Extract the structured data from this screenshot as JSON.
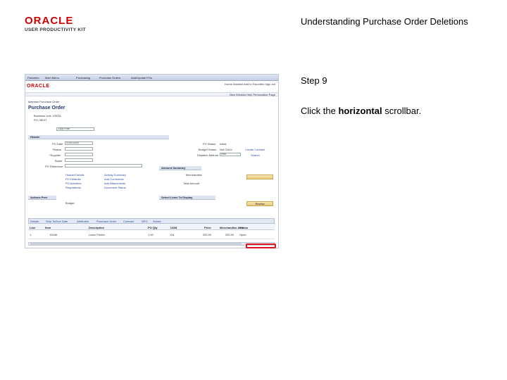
{
  "header": {
    "logo_text": "ORACLE",
    "logo_sub": "USER PRODUCTIVITY KIT",
    "document_title": "Understanding Purchase Order Deletions"
  },
  "step": {
    "label": "Step 9",
    "instruction_prefix": "Click the ",
    "instruction_bold": "horizontal",
    "instruction_suffix": " scrollbar."
  },
  "screenshot": {
    "tabs": [
      "Favorites",
      "Main Menu",
      "Purchasing",
      "Purchase Orders",
      "Add/Update POs"
    ],
    "brand": "ORACLE",
    "nav_links": "Home  Worklist  Add to Favorites  Sign out",
    "bar_links": "New Window  Help  Personalize Page",
    "breadcrumb": "Maintain Purchase Order",
    "page_title": "Purchase Order",
    "fields": {
      "business_unit_label": "Business Unit: US001",
      "po_label": "PO: NEXT",
      "copy_from": "Copy From",
      "header": "Header",
      "po_date_label": "PO Date",
      "po_date": "01/01/2009",
      "status_label": "*Status",
      "supplier_label": "*Supplier",
      "buyer_label": "Buyer",
      "po_ref_label": "PO Reference",
      "po_status_label": "PO Status",
      "po_status": "Initial",
      "budget_status_label": "Budget Status",
      "budget_status": "Not Chk'd",
      "dispatch_label": "Dispatch Method",
      "dispatch": "Print",
      "amount_summary": "Amount Summary",
      "merch_total": "Merchandise",
      "total_amount": "Total Amount",
      "create_contract": "Create Contract",
      "search": "Search"
    },
    "links": [
      "Header Details",
      "PO Defaults",
      "PO Activities",
      "Requisitions",
      "Activity Summary",
      "Add Comments",
      "Add Attachments",
      "Document Status"
    ],
    "actions_label": "Actions Prev",
    "budget_label": "Budget",
    "select_lines": "Select Lines To Display",
    "review_button": "Review",
    "grid_tabs": [
      "Details",
      "Ship To/Due Date",
      "Attributes",
      "Purchase Order",
      "Contract",
      "SPO",
      "Sched"
    ],
    "grid_headers": [
      "Line",
      "Item",
      "Description",
      "PO Qty",
      "UOM",
      "Price",
      "Merchandise Amt",
      "Status"
    ],
    "grid_row": [
      "1",
      "10046",
      "Laser Printer",
      "1.00",
      "EA",
      "250.00",
      "250.00",
      "Open"
    ]
  },
  "colors": {
    "highlight": "#e0141e",
    "brand_red": "#cc0000"
  }
}
